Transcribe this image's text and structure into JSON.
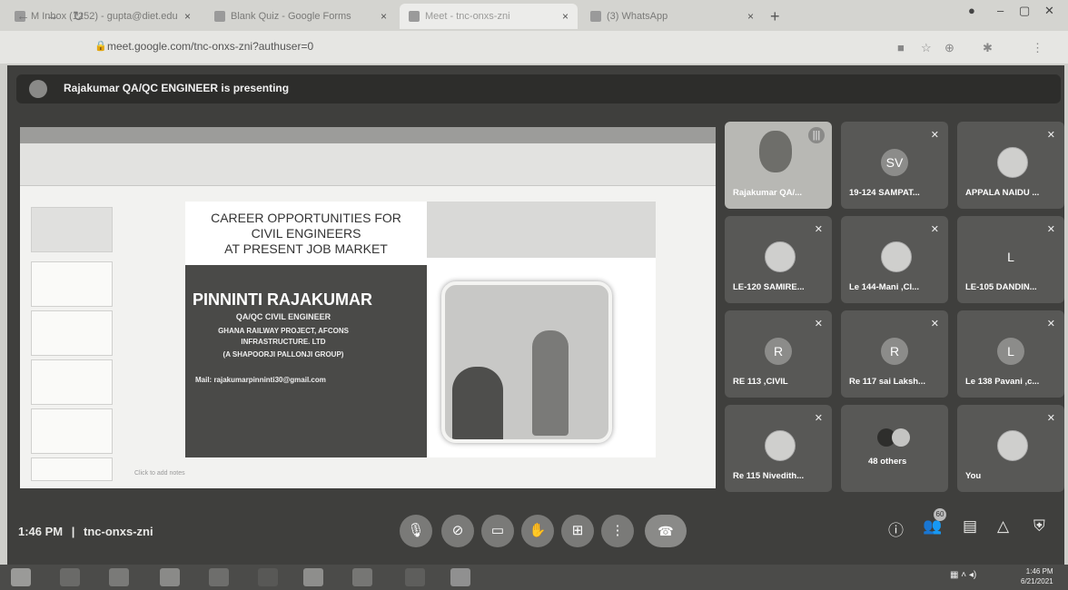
{
  "browser": {
    "tabs": [
      {
        "label": "M Inbox (1252) - gupta@diet.edu",
        "close": "×"
      },
      {
        "label": "Blank Quiz - Google Forms",
        "close": "×"
      },
      {
        "label": "Meet - tnc-onxs-zni",
        "close": "×"
      },
      {
        "label": "(3) WhatsApp",
        "close": "×"
      }
    ],
    "new_tab": "+",
    "url": "meet.google.com/tnc-onxs-zni?authuser=0"
  },
  "banner": {
    "text": "Rajakumar QA/QC ENGINEER is presenting"
  },
  "slide": {
    "title_lines": [
      "CAREER OPPORTUNITIES FOR",
      "CIVIL ENGINEERS",
      "AT PRESENT JOB MARKET"
    ],
    "name": "PINNINTI RAJAKUMAR",
    "details": [
      "QA/QC CIVIL ENGINEER",
      "GHANA RAILWAY PROJECT, AFCONS",
      "INFRASTRUCTURE. LTD",
      "(A SHAPOORJI PALLONJI GROUP)"
    ],
    "mail": "Mail: rajakumarpinninti30@gmail.com",
    "notes_hint": "Click to add notes"
  },
  "participants": [
    {
      "name": "Rajakumar QA/...",
      "initial": "",
      "kind": "video"
    },
    {
      "name": "19-124 SAMPAT...",
      "initial": "SV",
      "kind": "initial"
    },
    {
      "name": "APPALA NAIDU ...",
      "initial": "",
      "kind": "photo"
    },
    {
      "name": "LE-120 SAMIRE...",
      "initial": "",
      "kind": "photo"
    },
    {
      "name": "Le 144-Mani ,Cl...",
      "initial": "",
      "kind": "photo"
    },
    {
      "name": "LE-105 DANDIN...",
      "initial": "L",
      "kind": "initial"
    },
    {
      "name": "RE 113 ,CIVIL",
      "initial": "R",
      "kind": "initial"
    },
    {
      "name": "Re 117 sai Laksh...",
      "initial": "R",
      "kind": "initial"
    },
    {
      "name": "Le 138 Pavani ,c...",
      "initial": "L",
      "kind": "initial"
    },
    {
      "name": "Re 115 Nivedith...",
      "initial": "",
      "kind": "photo"
    },
    {
      "name": "48 others",
      "initial": "",
      "kind": "others"
    },
    {
      "name": "You",
      "initial": "",
      "kind": "photo"
    }
  ],
  "meeting": {
    "time": "1:46 PM",
    "code": "tnc-onxs-zni",
    "separator": "|",
    "people_count": "60"
  },
  "taskbar": {
    "time": "1:46 PM",
    "date": "6/21/2021"
  }
}
